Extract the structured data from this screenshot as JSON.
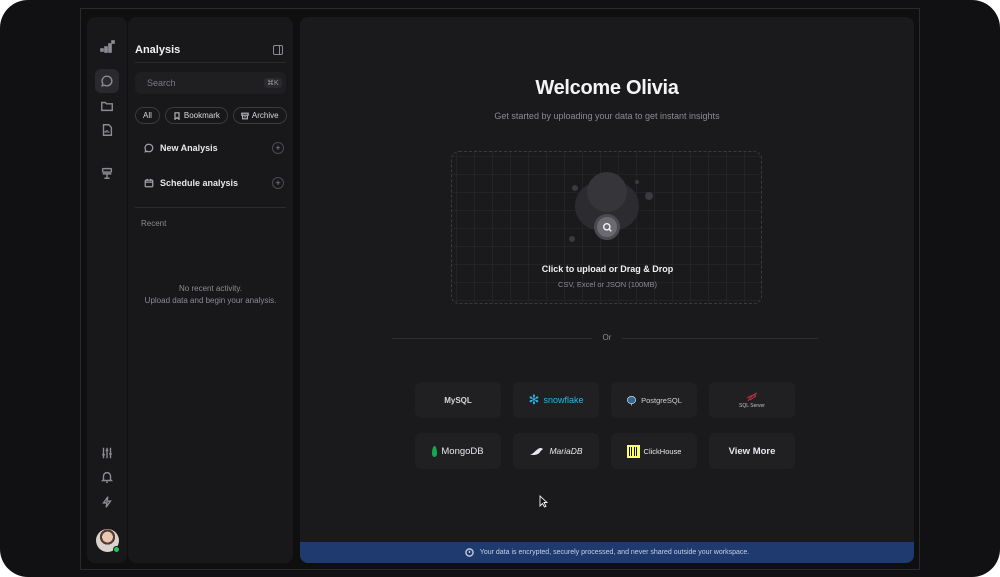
{
  "sidebar": {
    "title": "Analysis",
    "search_placeholder": "Search",
    "search_shortcut": "⌘K",
    "filters": [
      "All",
      "Bookmark",
      "Archive"
    ],
    "items": [
      {
        "label": "New Analysis",
        "icon": "chat-bubble-icon"
      },
      {
        "label": "Schedule analysis",
        "icon": "calendar-icon"
      }
    ],
    "recent_label": "Recent",
    "empty_line1": "No recent activity.",
    "empty_line2": "Upload data and begin your analysis."
  },
  "main": {
    "welcome": "Welcome Olivia",
    "subtitle": "Get started by uploading your data to get instant insights",
    "upload_title": "Click to upload or Drag & Drop",
    "upload_sub": "CSV, Excel or JSON (100MB)",
    "or_text": "Or",
    "connectors": [
      "MySQL",
      "snowflake",
      "PostgreSQL",
      "SQL Server",
      "MongoDB",
      "MariaDB",
      "ClickHouse",
      "View More"
    ],
    "banner": "Your data is encrypted, securely processed, and never shared outside your workspace."
  },
  "colors": {
    "background": "#1a1a1c",
    "sidebar": "#18181a",
    "banner": "#1e3a6e",
    "snowflake": "#29b5e8",
    "mongodb": "#13aa52",
    "clickhouse": "#faff69",
    "online": "#22c55e"
  }
}
